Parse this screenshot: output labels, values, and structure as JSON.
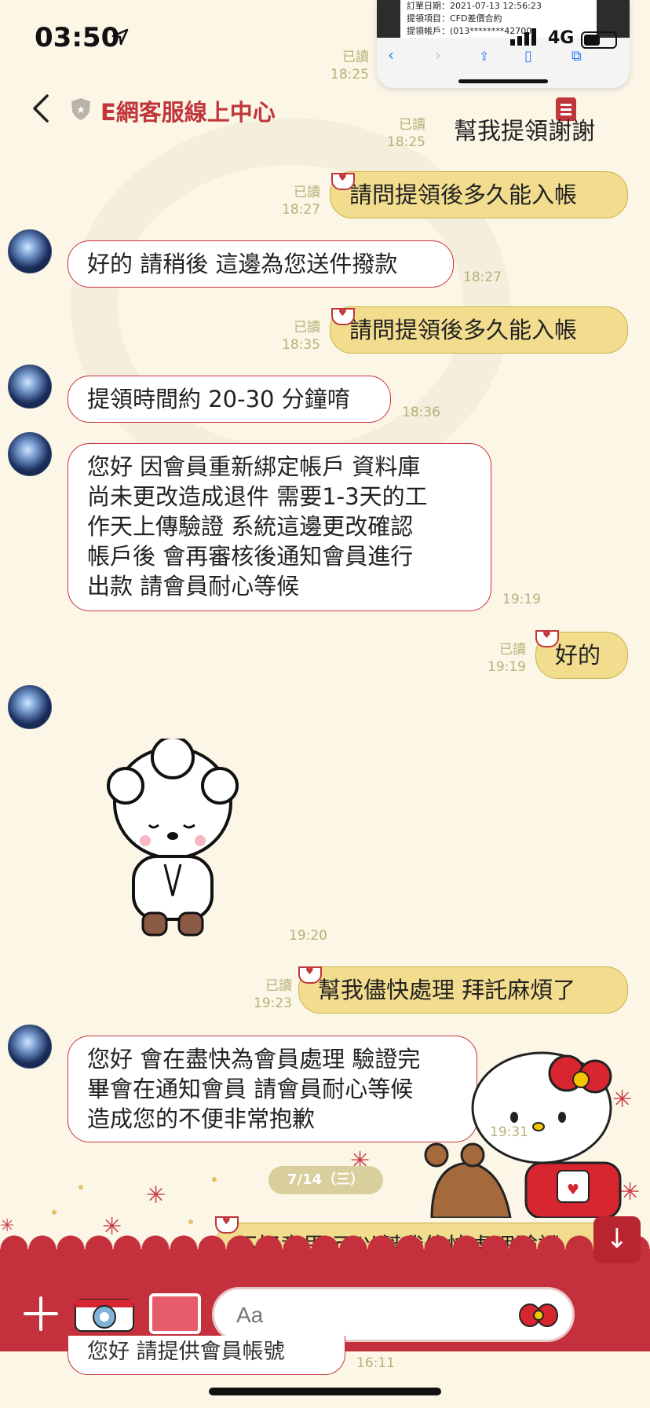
{
  "status_bar": {
    "time": "03:50",
    "network": "4G"
  },
  "pip_browser": {
    "doc_lines": [
      "訂單日期：2021-07-13 12:56:23",
      "提領項目：CFD差價合約",
      "提領帳戶：(013********42700"
    ]
  },
  "header": {
    "title": "E網客服線上中心"
  },
  "messages": [
    {
      "side": "out",
      "text": "幫我提領謝謝",
      "read": "已讀",
      "time": "18:25"
    },
    {
      "side": "out",
      "text": "請問提領後多久能入帳",
      "read": "已讀",
      "time": "18:27"
    },
    {
      "side": "in",
      "text": "好的 請稍後 這邊為您送件撥款",
      "time": "18:27"
    },
    {
      "side": "out",
      "text": "請問提領後多久能入帳",
      "read": "已讀",
      "time": "18:35"
    },
    {
      "side": "in",
      "text": "提領時間約 20-30 分鐘唷",
      "time": "18:36"
    },
    {
      "side": "in",
      "text": "您好 因會員重新綁定帳戶 資料庫\n尚未更改造成退件 需要1-3天的工\n作天上傳驗證 系統這邊更改確認\n帳戶後 會再審核後通知會員進行\n出款 請會員耐心等候",
      "time": "19:19"
    },
    {
      "side": "out",
      "text": "好的",
      "read": "已讀",
      "time": "19:19"
    },
    {
      "side": "in",
      "sticker": "sheep-bowing-sticker",
      "time": "19:20"
    },
    {
      "side": "out",
      "text": "幫我儘快處理 拜託麻煩了",
      "read": "已讀",
      "time": "19:23"
    },
    {
      "side": "in",
      "text": "您好 會在盡快為會員處理 驗證完\n畢會在通知會員 請會員耐心等候\n造成您的不便非常抱歉",
      "time": "19:31"
    },
    {
      "side": "out",
      "text": "不好意思 可以幫我儘快處理驗證",
      "partial": true
    },
    {
      "side": "in",
      "text": "您好 請提供會員帳號",
      "time": "16:11",
      "partial": true
    }
  ],
  "top_partial": {
    "read": "已讀",
    "time": "18:25"
  },
  "date_separator": "7/14（三）",
  "composer": {
    "placeholder": "Aa"
  },
  "colors": {
    "background": "#fbf6e6",
    "accent": "#c4313c",
    "outgoing_bubble": "#f2dc8e",
    "incoming_border": "#c9323f"
  }
}
